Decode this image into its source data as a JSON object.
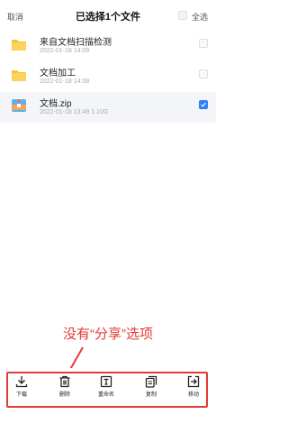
{
  "header": {
    "cancel": "取消",
    "title": "已选择1个文件",
    "select_all": "全选"
  },
  "files": [
    {
      "name": "来自文档扫描检测",
      "meta": "2022-01-18 14:09",
      "type": "folder",
      "selected": false
    },
    {
      "name": "文档加工",
      "meta": "2022-01-18 14:08",
      "type": "folder",
      "selected": false
    },
    {
      "name": "文档.zip",
      "meta": "2022-01-18 13:49    1.10G",
      "type": "zip",
      "selected": true
    }
  ],
  "annotation": "没有“分享”选项",
  "toolbar": {
    "download": "下载",
    "delete": "删除",
    "rename": "重命名",
    "copy": "复制",
    "move": "移动"
  },
  "colors": {
    "accent": "#2d7ff9",
    "annotation": "#e53935",
    "folder": "#f7c23b"
  },
  "icons": [
    "folder-icon",
    "zip-icon",
    "download-icon",
    "trash-icon",
    "rename-icon",
    "copy-icon",
    "move-icon"
  ]
}
